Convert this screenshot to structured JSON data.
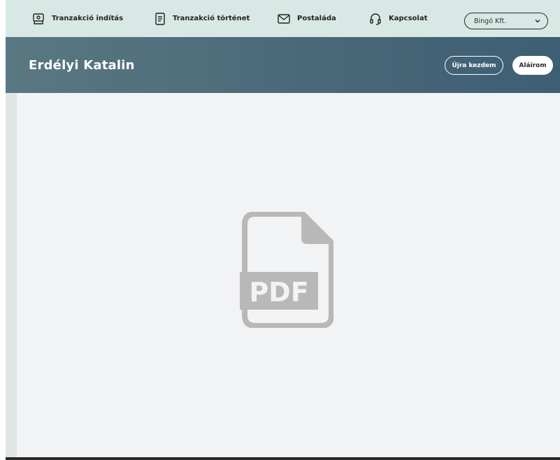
{
  "nav": {
    "items": [
      {
        "label": "Tranzakció indítás",
        "icon": "banknote-hand-icon"
      },
      {
        "label": "Tranzakció történet",
        "icon": "document-list-icon"
      },
      {
        "label": "Postaláda",
        "icon": "envelope-icon"
      },
      {
        "label": "Kapcsolat",
        "icon": "headset-icon"
      }
    ],
    "company_select": {
      "value": "Bingó Kft."
    }
  },
  "header": {
    "title": "Erdélyi Katalin",
    "restart_label": "Újra kezdem",
    "sign_label": "Aláírom"
  },
  "viewer": {
    "placeholder_icon": "pdf-file-icon",
    "placeholder_text": "PDF"
  },
  "colors": {
    "nav_bg": "#d8e8e4",
    "header_bg": "#4a6878",
    "content_bg": "#f2f3f5",
    "pdf_icon": "#b8b8b8"
  }
}
